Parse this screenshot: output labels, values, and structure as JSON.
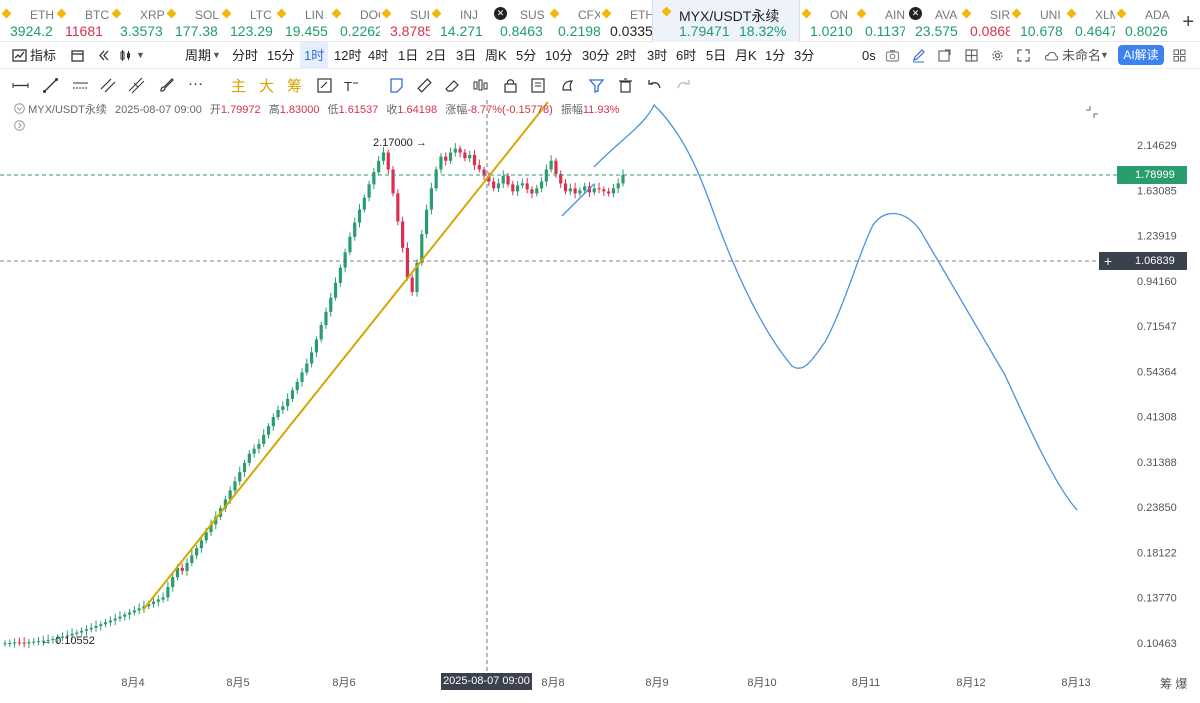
{
  "tickers": [
    {
      "symbol": "ETH",
      "price": "3924.2",
      "color": "#1f9e6b"
    },
    {
      "symbol": "BTC",
      "price": "11681",
      "color": "#d9304f"
    },
    {
      "symbol": "XRP",
      "price": "3.3573",
      "color": "#1f9e6b"
    },
    {
      "symbol": "SOL",
      "price": "177.38",
      "color": "#1f9e6b"
    },
    {
      "symbol": "LTC",
      "price": "123.29",
      "color": "#1f9e6b"
    },
    {
      "symbol": "LIN",
      "price": "19.455",
      "color": "#1f9e6b"
    },
    {
      "symbol": "DOG",
      "price": "0.2262",
      "color": "#1f9e6b"
    },
    {
      "symbol": "SUI",
      "price": "3.8785",
      "color": "#d9304f"
    },
    {
      "symbol": "INJ",
      "price": "14.271",
      "color": "#1f9e6b"
    },
    {
      "symbol": "SUS",
      "price": "0.8463",
      "color": "#1f9e6b"
    },
    {
      "symbol": "CFX",
      "price": "0.2198",
      "color": "#1f9e6b"
    },
    {
      "symbol": "ETH",
      "price": "0.0335",
      "color": "#222222"
    },
    {
      "symbol": "MYX/USDT永续",
      "price": "1.79471",
      "change": "18.32%",
      "color": "#1f9e6b",
      "active": true
    },
    {
      "symbol": "ON",
      "price": "1.0210",
      "color": "#1f9e6b"
    },
    {
      "symbol": "AIN",
      "price": "0.1137",
      "color": "#1f9e6b"
    },
    {
      "symbol": "AVA",
      "price": "23.575",
      "color": "#1f9e6b"
    },
    {
      "symbol": "SIRI",
      "price": "0.0868",
      "color": "#d9304f"
    },
    {
      "symbol": "UNI",
      "price": "10.678",
      "color": "#1f9e6b"
    },
    {
      "symbol": "XLM",
      "price": "0.4647",
      "color": "#1f9e6b"
    },
    {
      "symbol": "ADA",
      "price": "0.8026",
      "color": "#1f9e6b"
    }
  ],
  "toolbar": {
    "indicators": "指标",
    "period": "周期",
    "intervals": [
      "分时",
      "15分",
      "1时",
      "12时",
      "4时",
      "1日",
      "2日",
      "3日",
      "周K",
      "5分",
      "10分",
      "30分",
      "2时",
      "3时",
      "6时",
      "5日",
      "月K",
      "1分",
      "3分"
    ],
    "selected_interval": "1时",
    "replay": "0s",
    "unnamed": "未命名",
    "ai": "AI解读"
  },
  "drawing": {
    "chars": [
      "主",
      "大",
      "筹"
    ]
  },
  "info": {
    "symbol": "MYX/USDT永续",
    "datetime": "2025-08-07 09:00",
    "open_label": "开",
    "open": "1.79972",
    "high_label": "高",
    "high": "1.83000",
    "low_label": "低",
    "low": "1.61537",
    "close_label": "收",
    "close": "1.64198",
    "change_label": "涨幅",
    "change": "-8.77%(-0.15778)",
    "amp_label": "振幅",
    "amp": "11.93%"
  },
  "chart_data": {
    "type": "candlestick",
    "y_scale": "log",
    "y_ticks": [
      "2.14629",
      "1.63085",
      "1.23919",
      "0.94160",
      "0.71547",
      "0.54364",
      "0.41308",
      "0.31388",
      "0.23850",
      "0.18122",
      "0.13770",
      "0.10463"
    ],
    "x_ticks": [
      "8月4",
      "8月5",
      "8月6",
      "8月7",
      "8月8",
      "8月9",
      "8月10",
      "8月11",
      "8月12",
      "8月13"
    ],
    "current_price": "1.78999",
    "crosshair_price": "1.06839",
    "crosshair_time": "2025-08-07 09:00",
    "high_marker": "2.17000",
    "low_marker": "0.10552",
    "closes": [
      0.1045,
      0.1046,
      0.105,
      0.1048,
      0.1044,
      0.1052,
      0.1055,
      0.1058,
      0.1061,
      0.1066,
      0.1072,
      0.108,
      0.1088,
      0.1096,
      0.1106,
      0.1115,
      0.1126,
      0.1137,
      0.1147,
      0.116,
      0.1172,
      0.1186,
      0.1199,
      0.1213,
      0.1228,
      0.1243,
      0.1259,
      0.1275,
      0.1291,
      0.1308,
      0.1326,
      0.1344,
      0.1362,
      0.138,
      0.147,
      0.156,
      0.165,
      0.162,
      0.17,
      0.178,
      0.186,
      0.195,
      0.205,
      0.215,
      0.225,
      0.237,
      0.25,
      0.264,
      0.279,
      0.295,
      0.312,
      0.33,
      0.34,
      0.35,
      0.37,
      0.39,
      0.412,
      0.43,
      0.44,
      0.46,
      0.485,
      0.51,
      0.54,
      0.57,
      0.61,
      0.66,
      0.72,
      0.78,
      0.85,
      0.93,
      1.02,
      1.12,
      1.23,
      1.34,
      1.45,
      1.56,
      1.69,
      1.82,
      1.95,
      2.05,
      1.85,
      1.6,
      1.35,
      1.15,
      0.96,
      0.88,
      1.05,
      1.25,
      1.45,
      1.65,
      1.85,
      2.0,
      1.95,
      2.05,
      2.1,
      2.05,
      1.98,
      2.02,
      1.9,
      1.85,
      1.78,
      1.72,
      1.65,
      1.7,
      1.78,
      1.69,
      1.62,
      1.68,
      1.7,
      1.64,
      1.6,
      1.65,
      1.72,
      1.85,
      1.95,
      1.8,
      1.7,
      1.62,
      1.65,
      1.6,
      1.63,
      1.67,
      1.61,
      1.65,
      1.64,
      1.62,
      1.6,
      1.65,
      1.7,
      1.79
    ],
    "trendline": [
      [
        0.13,
        14
      ],
      [
        2.55,
        106
      ]
    ],
    "projection": "forecast curve: rise to ~2.55 near 8月9, fall to ~0.56 on 8月10, rebound to ~1.38 on 8月11, decline to ~0.24 by 8月13"
  }
}
